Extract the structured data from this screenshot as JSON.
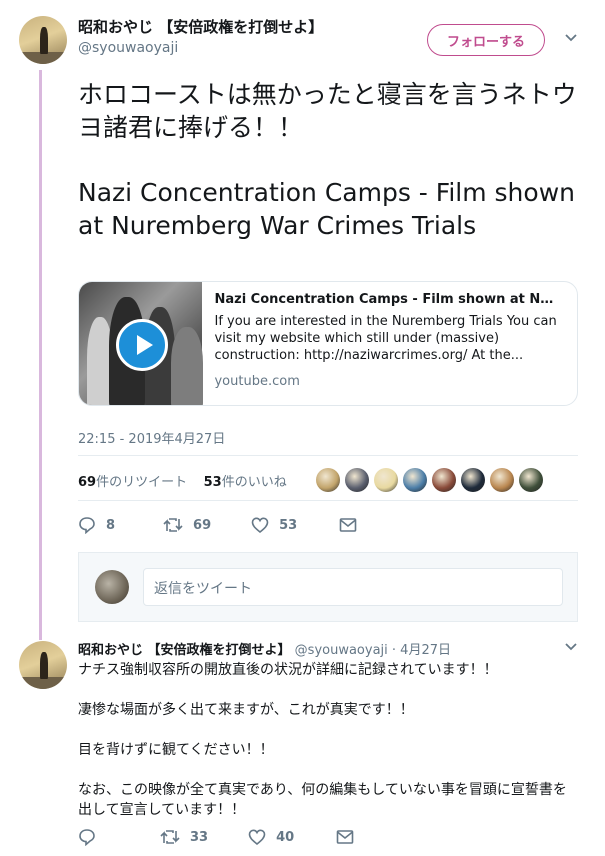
{
  "main_tweet": {
    "author_name": "昭和おやじ 【安倍政権を打倒せよ】",
    "author_handle": "@syouwaoyaji",
    "follow_label": "フォローする",
    "text_line1": "ホロコーストは無かったと寝言を言うネトウヨ諸君に捧げる！！",
    "text_line2": "Nazi Concentration Camps - Film shown at Nuremberg War Crimes Trials",
    "card": {
      "title": "Nazi Concentration Camps - Film shown at N…",
      "description": "If you are interested in the Nuremberg Trials You can visit my website which still under (massive) construction: http://naziwarcrimes.org/ At the...",
      "domain": "youtube.com"
    },
    "timestamp": "22:15 - 2019年4月27日",
    "retweets_count": "69",
    "retweets_label": "件のリツイート",
    "likes_count": "53",
    "likes_label": "件のいいね",
    "actions": {
      "reply": "8",
      "retweet": "69",
      "like": "53"
    },
    "reply_placeholder": "返信をツイート"
  },
  "second_tweet": {
    "author_name": "昭和おやじ 【安倍政権を打倒せよ】",
    "author_handle": "@syouwaoyaji",
    "date": "· 4月27日",
    "paragraphs": [
      "ナチス強制収容所の開放直後の状況が詳細に記録されています！！",
      "凄惨な場面が多く出て来ますが、これが真実です！！",
      "目を背けずに観てください！！",
      "なお、この映像が全て真実であり、何の編集もしていない事を冒頭に宣誓書を出して宣言しています！！"
    ],
    "actions": {
      "reply": "",
      "retweet": "33",
      "like": "40"
    }
  },
  "colors": {
    "accent": "#c04c8e",
    "thread_line": "#d9b8dd",
    "muted": "#657786",
    "play": "#1d8fd8"
  },
  "likers": [
    "#c2a46b",
    "#5a5f6e",
    "#e8d9a0",
    "#4c7ea8",
    "#8a4b3a",
    "#1e2a3a",
    "#b9864f",
    "#3f4f3a"
  ]
}
